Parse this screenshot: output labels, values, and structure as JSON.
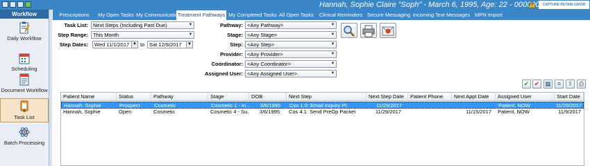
{
  "window": {
    "patient_title": "Hannah, Sophie Claire \"Soph\" - March 6, 1995, Age: 22 - 000000002",
    "brand_logo": "CAPTURE RETAIN GROW",
    "warning_icon": "warning-triangle-icon"
  },
  "sidebar": {
    "header": "Workflow",
    "items": [
      {
        "label": "Daily Workflow",
        "icon": "clipboard-pencil-icon"
      },
      {
        "label": "Scheduling",
        "icon": "calendar-icon"
      },
      {
        "label": "Document Workflow",
        "icon": "document-icon"
      },
      {
        "label": "Task List",
        "icon": "task-list-icon",
        "active": true
      },
      {
        "label": "Batch Processing",
        "icon": "atom-icon"
      }
    ]
  },
  "tabs": [
    {
      "label": "Prescriptions"
    },
    {
      "label": "My Open Tasks"
    },
    {
      "label": "My Communications"
    },
    {
      "label": "Treatment Pathways",
      "active": true
    },
    {
      "label": "My Completed Tasks"
    },
    {
      "label": "All Open Tasks"
    },
    {
      "label": "Clinical Reminders"
    },
    {
      "label": "Secure Messaging"
    },
    {
      "label": "Incoming Text Messages"
    },
    {
      "label": "MPN Import"
    }
  ],
  "filters": {
    "task_list_label": "Task List:",
    "task_list_value": "Next Steps (Including Past Due)",
    "step_range_label": "Step Range:",
    "step_range_value": "This Month",
    "step_dates_label": "Step Dates:",
    "step_date_from": "Wed 11/1/2017",
    "to_label": "to",
    "step_date_to": "Sat 12/9/2017",
    "pathway_label": "Pathway:",
    "pathway_value": "<Any Pathway>",
    "stage_label": "Stage:",
    "stage_value": "<Any Stage>",
    "step_label": "Step:",
    "step_value": "<Any Step>",
    "provider_label": "Provider:",
    "provider_value": "<Any Provider>",
    "coordinator_label": "Coordinator:",
    "coordinator_value": "<Any Coordinator>",
    "assigned_user_label": "Assigned User:",
    "assigned_user_value": "<Any Assigned User>"
  },
  "action_buttons": [
    "search-magnifier-icon",
    "printer-icon",
    "email-icon"
  ],
  "grid_toolbar": [
    "green-check-icon",
    "red-check-icon",
    "grid-settings-icon",
    "lines-icon",
    "export-icon",
    "print-small-icon"
  ],
  "grid": {
    "columns": [
      "Patient Name",
      "Status",
      "Pathway",
      "Stage",
      "DOB",
      "Next Step",
      "Next Step Date",
      "Patient Phone",
      "Next Appt Date",
      "Assigned User",
      "Start Date"
    ],
    "rows": [
      {
        "selected": true,
        "cells": [
          "Hannah, Sophie",
          "Prospect",
          "Cosmetic",
          "Cosmetic 1 - In...",
          "3/6/1995",
          "Cos 1.0: Email Inquiry Pt",
          "11/29/2017",
          "",
          "",
          "Patient, NOW",
          "11/29/2017"
        ]
      },
      {
        "selected": false,
        "cells": [
          "Hannah, Sophie",
          "Open",
          "Cosmetic",
          "Cosmetic 4 - Su...",
          "3/6/1995",
          "Cos 4.1: Send PreOp Packet",
          "11/29/2017",
          "",
          "11/15/2017",
          "Patient, NOW",
          "11/9/2017"
        ]
      }
    ]
  },
  "colors": {
    "title_bar": "#3a86c7",
    "sidebar_header": "#2f6aa3",
    "selected_row": "#3399ff",
    "active_sidebar": "#f6e3c8"
  }
}
